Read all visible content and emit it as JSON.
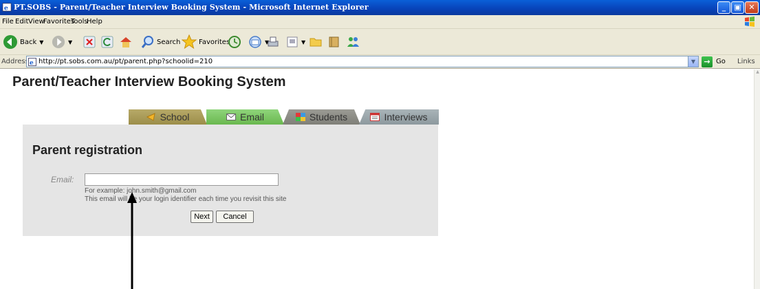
{
  "window": {
    "title": "PT.SOBS - Parent/Teacher Interview Booking System - Microsoft Internet Explorer",
    "icon": "ie-icon",
    "controls": [
      "minimize",
      "maximize",
      "close"
    ]
  },
  "menubar": {
    "items": [
      "File",
      "Edit",
      "View",
      "Favorites",
      "Tools",
      "Help"
    ]
  },
  "toolbar": {
    "back_label": "Back",
    "search_label": "Search",
    "favorites_label": "Favorites"
  },
  "addressbar": {
    "label": "Address",
    "url": "http://pt.sobs.com.au/pt/parent.php?schoolid=210",
    "go_label": "Go",
    "links_label": "Links"
  },
  "page": {
    "title": "Parent/Teacher Interview Booking System",
    "tabs": [
      {
        "label": "School",
        "icon": "school-icon",
        "color": "#a89a55"
      },
      {
        "label": "Email",
        "icon": "email-icon",
        "color": "#7cc565"
      },
      {
        "label": "Students",
        "icon": "students-icon",
        "color": "#8f8f88"
      },
      {
        "label": "Interviews",
        "icon": "interviews-icon",
        "color": "#9aa6ab"
      }
    ],
    "active_tab": "Email",
    "heading": "Parent registration",
    "email_label": "Email:",
    "email_value": "",
    "hint_example": "For example: john.smith@gmail.com",
    "hint_identifier": "This email will be your login identifier each time you revisit this site",
    "next_label": "Next",
    "cancel_label": "Cancel"
  },
  "colors": {
    "titlebar": "#0842b8",
    "chrome": "#ece9d8",
    "panel": "#e5e5e5"
  }
}
